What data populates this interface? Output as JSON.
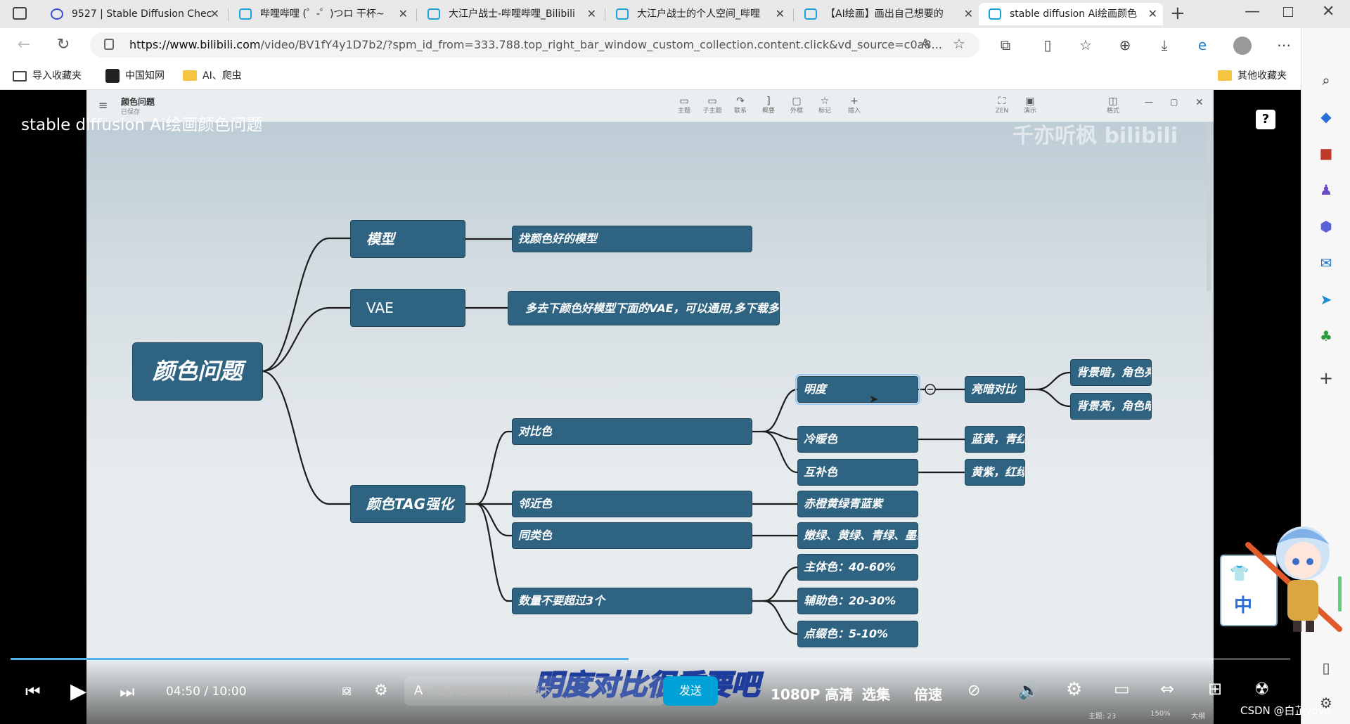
{
  "browser": {
    "tabs": [
      {
        "label": "9527 | Stable Diffusion Chec",
        "active": false
      },
      {
        "label": "哔哩哔哩 (゜-゜)つロ 干杯~",
        "active": false
      },
      {
        "label": "大江户战士-哔哩哔哩_Bilibili",
        "active": false
      },
      {
        "label": "大江户战士的个人空间_哔哩",
        "active": false
      },
      {
        "label": "【AI绘画】画出自己想要的",
        "active": false
      },
      {
        "label": "stable diffusion Ai绘画颜色",
        "active": true
      }
    ],
    "url_domain": "https://www.bilibili.com",
    "url_rest": "/video/BV1fY4y1D7b2/?spm_id_from=333.788.top_right_bar_window_custom_collection.content.click&vd_source=c0a8...",
    "bookmarks": {
      "import": "导入收藏夹",
      "cnki": "中国知网",
      "ai": "AI、爬虫",
      "other": "其他收藏夹"
    }
  },
  "video": {
    "title": "stable diffusion Ai绘画颜色问题",
    "watermark": "千亦听枫 bilibili",
    "current_time": "04:50",
    "separator": "/",
    "duration": "10:00",
    "progress": 0.483,
    "danmu_placeholder": "发个友善的弹幕见证当下",
    "send_label": "发送",
    "quality": "1080P 高清",
    "episodes": "选集",
    "speed": "倍速",
    "subtitle": "明度对比很重要吧",
    "csdn_credit": "CSDN @白芷yoyo"
  },
  "mindmap_app": {
    "doc_title": "颜色问题",
    "doc_status": "已保存",
    "tools": [
      "主题",
      "子主题",
      "联系",
      "概要",
      "外框",
      "标记",
      "插入"
    ],
    "zen": "ZEN",
    "present": "演示",
    "format": "格式",
    "status_topics": "主题: 23",
    "zoom": "150%",
    "outline": "大纲"
  },
  "mindmap": {
    "root": "颜色问题",
    "model": "模型",
    "model_child": "找颜色好的模型",
    "vae": "VAE",
    "vae_child": "多去下颜色好模型下面的VAE，可以通用,多下载多试",
    "tag": "颜色TAG强化",
    "contrast": "对比色",
    "brightness": "明度",
    "light_dark": "亮暗对比",
    "bg_dark": "背景暗，角色亮",
    "bg_light": "背景亮，角色暗",
    "warm_cold": "冷暖色",
    "warm_cold_child": "蓝黄，青红",
    "complement": "互补色",
    "complement_child": "黄紫，红绿",
    "adjacent": "邻近色",
    "adjacent_child": "赤橙黄绿青蓝紫",
    "similar": "同类色",
    "similar_child": "嫩绿、黄绿、青绿、墨绿",
    "count": "数量不要超过3个",
    "main": "主体色：40-60%",
    "aux": "辅助色：20-30%",
    "accent": "点缀色：5-10%"
  }
}
